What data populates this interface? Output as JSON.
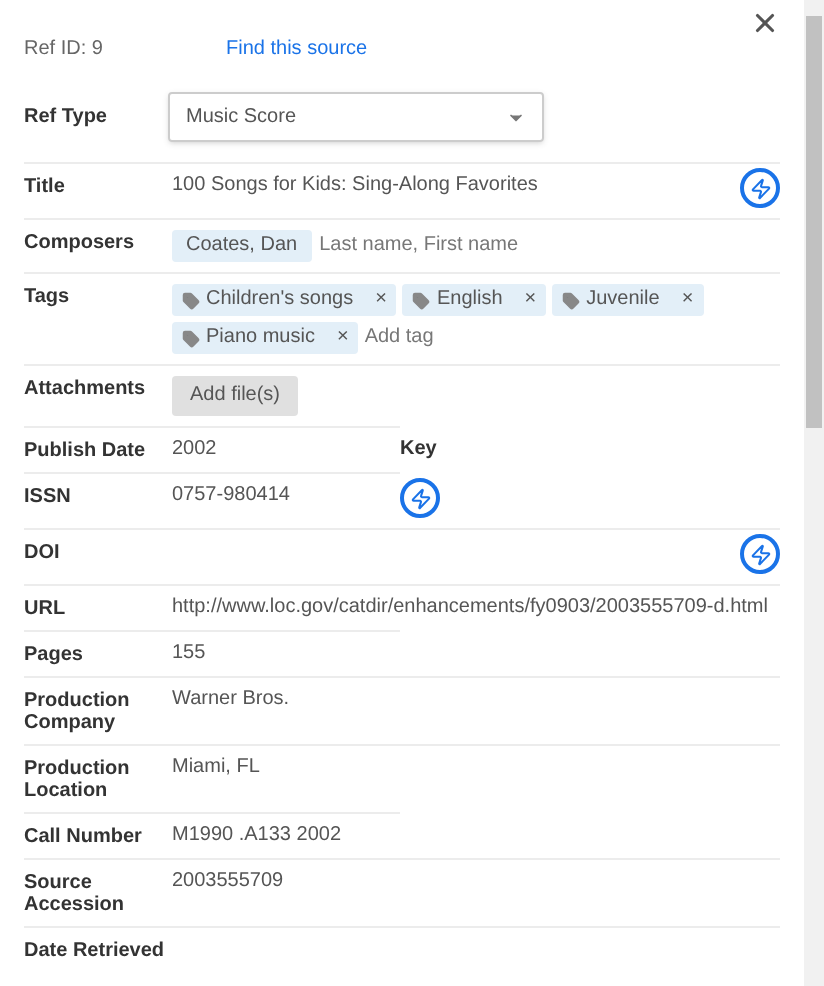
{
  "header": {
    "ref_id": "Ref ID: 9",
    "link": "Find this source"
  },
  "ref_type": {
    "label": "Ref Type",
    "value": "Music Score"
  },
  "fields": [
    {
      "kind": "text",
      "label": "Title",
      "value": "100 Songs for Kids: Sing-Along Favorites",
      "lookup": true
    },
    {
      "kind": "people",
      "label": "Composers",
      "chips": [
        "Coates, Dan"
      ],
      "placeholder": "Last name, First name"
    },
    {
      "kind": "tags",
      "label": "Tags",
      "chips": [
        {
          "label": "Children's songs",
          "remove": "×"
        },
        {
          "label": "English",
          "remove": "×"
        },
        {
          "label": "Juvenile",
          "remove": "×"
        },
        {
          "label": "Piano music",
          "remove": "×"
        }
      ],
      "placeholder": "Add tag"
    },
    {
      "kind": "button",
      "label": "Attachments",
      "value": "Add file(s)"
    },
    {
      "kind": "text",
      "label": "Publish Date",
      "value": "2002",
      "half": true,
      "side_label": "Key"
    },
    {
      "kind": "text",
      "label": "ISSN",
      "value": "0757-980414",
      "half": true,
      "lookup": true
    },
    {
      "kind": "text",
      "label": "DOI",
      "lookup": true
    },
    {
      "kind": "text",
      "label": "URL",
      "value": "http://www.loc.gov/catdir/enhancements/fy0903/2003555709-d.html"
    },
    {
      "kind": "text",
      "label": "Pages",
      "value": "155",
      "half": true
    },
    {
      "kind": "text",
      "label": "Production Company",
      "value": "Warner Bros."
    },
    {
      "kind": "text",
      "label": "Production Location",
      "value": "Miami, FL"
    },
    {
      "kind": "text",
      "label": "Call Number",
      "value": "M1990 .A133 2002",
      "half": true
    },
    {
      "kind": "text",
      "label": "Source Accession",
      "value": "2003555709"
    },
    {
      "kind": "text",
      "label": "Date Retrieved"
    }
  ]
}
